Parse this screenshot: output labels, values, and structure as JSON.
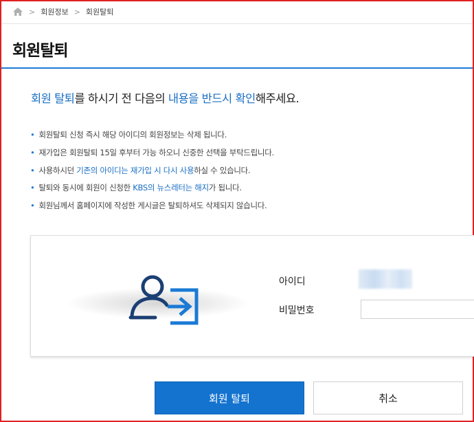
{
  "breadcrumb": {
    "items": [
      "회원정보",
      "회원탈퇴"
    ]
  },
  "page": {
    "title": "회원탈퇴"
  },
  "lead": {
    "p1": "회원 탈퇴",
    "p2": "를 하시기 전 다음의 ",
    "p3": "내용을 반드시 확인",
    "p4": "해주세요."
  },
  "notices": {
    "n1": "회원탈퇴 신청 즉시 해당 아이디의 회원정보는 삭제 됩니다.",
    "n2": "재가입은 회원탈퇴 15일 후부터 가능 하오니 신중한 선택을 부탁드립니다.",
    "n3": {
      "a": "사용하시던 ",
      "b": "기존의 아이디는 재가입 시 다시 사용",
      "c": "하실 수 있습니다."
    },
    "n4": {
      "a": "탈퇴와 동시에 회원이 신청한 ",
      "b": "KBS의 뉴스레터는 해지",
      "c": "가 됩니다."
    },
    "n5": "회원님께서 홈페이지에 작성한 게시글은 탈퇴하셔도 삭제되지 않습니다."
  },
  "form": {
    "id_label": "아이디",
    "password_label": "비밀번호",
    "password_value": ""
  },
  "buttons": {
    "withdraw": "회원 탈퇴",
    "cancel": "취소"
  },
  "colors": {
    "accent": "#1a7ad4",
    "primary_button": "#1473cf"
  },
  "icons": {
    "home": "home-icon",
    "separator": "chevron-right-icon",
    "login": "user-login-icon"
  }
}
